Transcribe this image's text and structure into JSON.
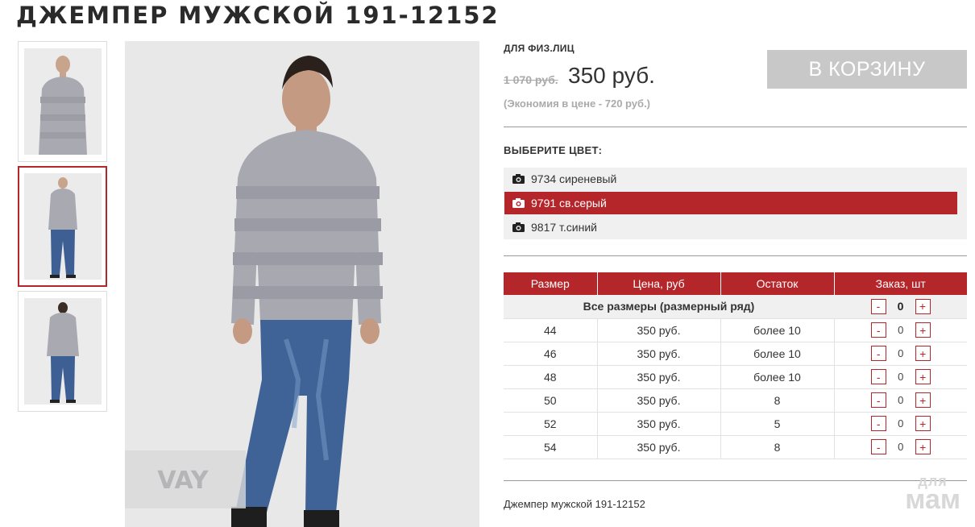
{
  "product": {
    "title": "ДЖЕМПЕР МУЖСКОЙ 191-12152",
    "description": "Джемпер мужской 191-12152"
  },
  "thumbnails": [
    {
      "name": "front-waist",
      "active": false
    },
    {
      "name": "front-full",
      "active": true
    },
    {
      "name": "back-full",
      "active": false
    }
  ],
  "main_photo": {
    "brand_mark": "VAY"
  },
  "pricing": {
    "customer_type": "ДЛЯ ФИЗ.ЛИЦ",
    "old_price": "1 070 руб.",
    "new_price": "350 руб.",
    "economy": "(Экономия в цене - 720 руб.)",
    "cart_button": "В КОРЗИНУ"
  },
  "colors": {
    "heading": "ВЫБЕРИТЕ ЦВЕТ:",
    "items": [
      {
        "label": "9734 сиреневый",
        "selected": false,
        "icon": "camera-icon"
      },
      {
        "label": "9791 св.серый",
        "selected": true,
        "icon": "camera-icon"
      },
      {
        "label": "9817 т.синий",
        "selected": false,
        "icon": "camera-icon"
      }
    ]
  },
  "size_table": {
    "headers": [
      "Размер",
      "Цена, руб",
      "Остаток",
      "Заказ, шт"
    ],
    "all_sizes_label": "Все размеры (размерный ряд)",
    "all_sizes_qty": "0",
    "minus": "-",
    "plus": "+",
    "rows": [
      {
        "size": "44",
        "price": "350 руб.",
        "stock": "более 10",
        "qty": "0"
      },
      {
        "size": "46",
        "price": "350 руб.",
        "stock": "более 10",
        "qty": "0"
      },
      {
        "size": "48",
        "price": "350 руб.",
        "stock": "более 10",
        "qty": "0"
      },
      {
        "size": "50",
        "price": "350 руб.",
        "stock": "8",
        "qty": "0"
      },
      {
        "size": "52",
        "price": "350 руб.",
        "stock": "5",
        "qty": "0"
      },
      {
        "size": "54",
        "price": "350 руб.",
        "stock": "8",
        "qty": "0"
      }
    ]
  },
  "watermark": {
    "line1": "для",
    "line2": "мам"
  },
  "colors_palette": {
    "accent": "#b5262b",
    "cart_bg": "#c8c8c8",
    "muted": "#aaaaaa"
  }
}
